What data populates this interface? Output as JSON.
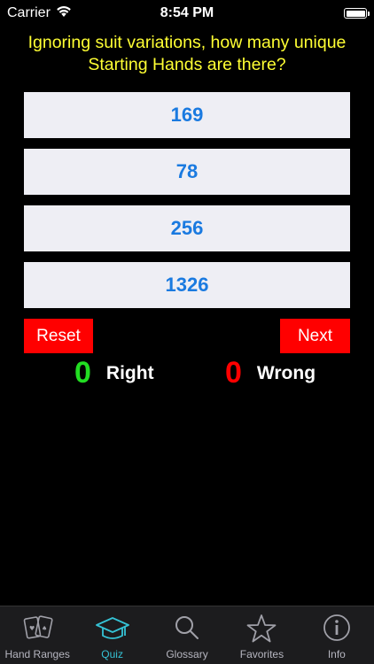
{
  "status_bar": {
    "carrier": "Carrier",
    "time": "8:54 PM"
  },
  "quiz": {
    "question": "Ignoring suit variations, how many unique Starting Hands are there?",
    "answers": [
      "169",
      "78",
      "256",
      "1326"
    ]
  },
  "controls": {
    "reset_label": "Reset",
    "next_label": "Next"
  },
  "score": {
    "right_count": "0",
    "right_label": "Right",
    "wrong_count": "0",
    "wrong_label": "Wrong"
  },
  "tabs": [
    {
      "label": "Hand Ranges",
      "icon": "cards-icon"
    },
    {
      "label": "Quiz",
      "icon": "graduation-cap-icon",
      "active": true
    },
    {
      "label": "Glossary",
      "icon": "magnifier-icon"
    },
    {
      "label": "Favorites",
      "icon": "star-icon"
    },
    {
      "label": "Info",
      "icon": "info-icon"
    }
  ],
  "colors": {
    "question": "#ffff33",
    "answer_text": "#1a7ae0",
    "answer_bg": "#eeeef4",
    "button_red": "#ff0000",
    "right_green": "#22dd22",
    "wrong_red": "#ff0000",
    "tab_active": "#35c3d6"
  }
}
